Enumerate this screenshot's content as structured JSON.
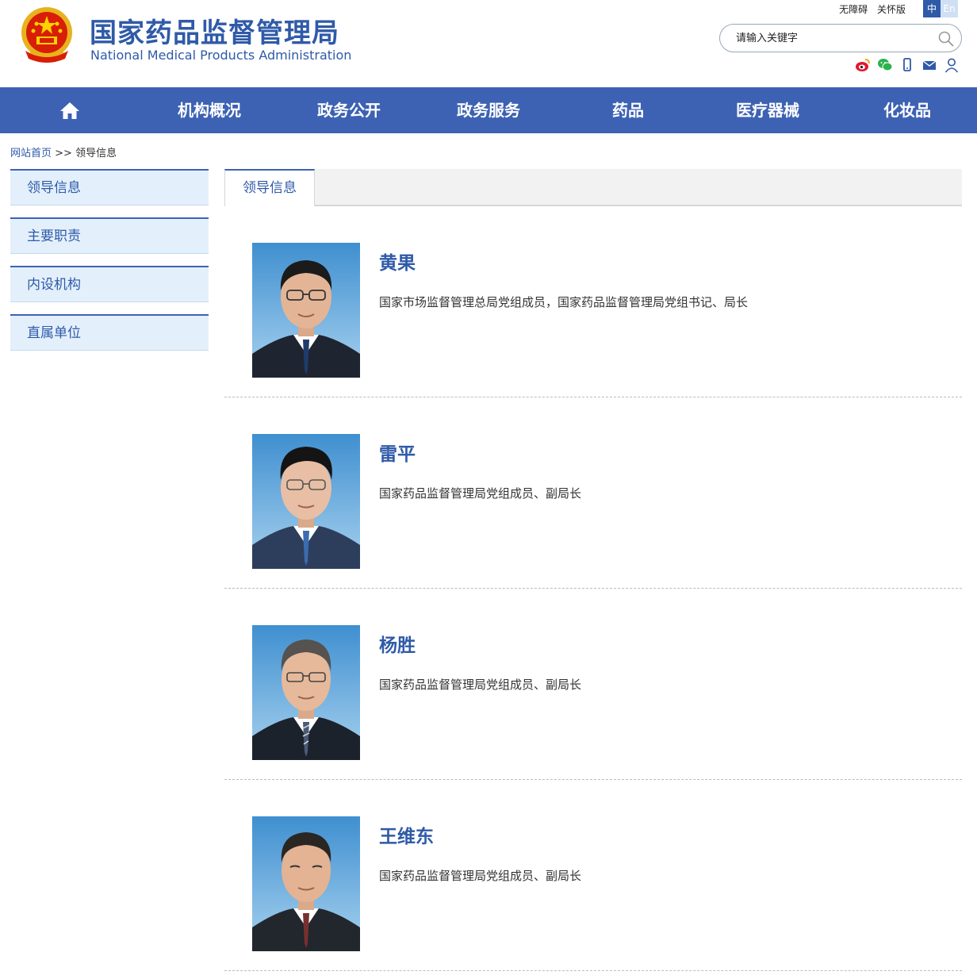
{
  "header": {
    "title_cn": "国家药品监督管理局",
    "title_en": "National Medical Products Administration",
    "accessibility": "无障碍",
    "care_mode": "关怀版",
    "lang_cn": "中",
    "lang_en": "En",
    "search_placeholder": "请输入关键字"
  },
  "nav": [
    "机构概况",
    "政务公开",
    "政务服务",
    "药品",
    "医疗器械",
    "化妆品"
  ],
  "breadcrumb": {
    "home": "网站首页",
    "sep": ">>",
    "current": "领导信息"
  },
  "sidebar": [
    "领导信息",
    "主要职责",
    "内设机构",
    "直属单位"
  ],
  "tab": "领导信息",
  "leaders": [
    {
      "name": "黄果",
      "position": "国家市场监督管理总局党组成员，国家药品监督管理局党组书记、局长"
    },
    {
      "name": "雷平",
      "position": "国家药品监督管理局党组成员、副局长"
    },
    {
      "name": "杨胜",
      "position": "国家药品监督管理局党组成员、副局长"
    },
    {
      "name": "王维东",
      "position": "国家药品监督管理局党组成员、副局长"
    }
  ],
  "colors": {
    "brand": "#2f5aa8",
    "nav_bg": "#3d62b3",
    "sidebar_bg": "#e3f0fc"
  }
}
